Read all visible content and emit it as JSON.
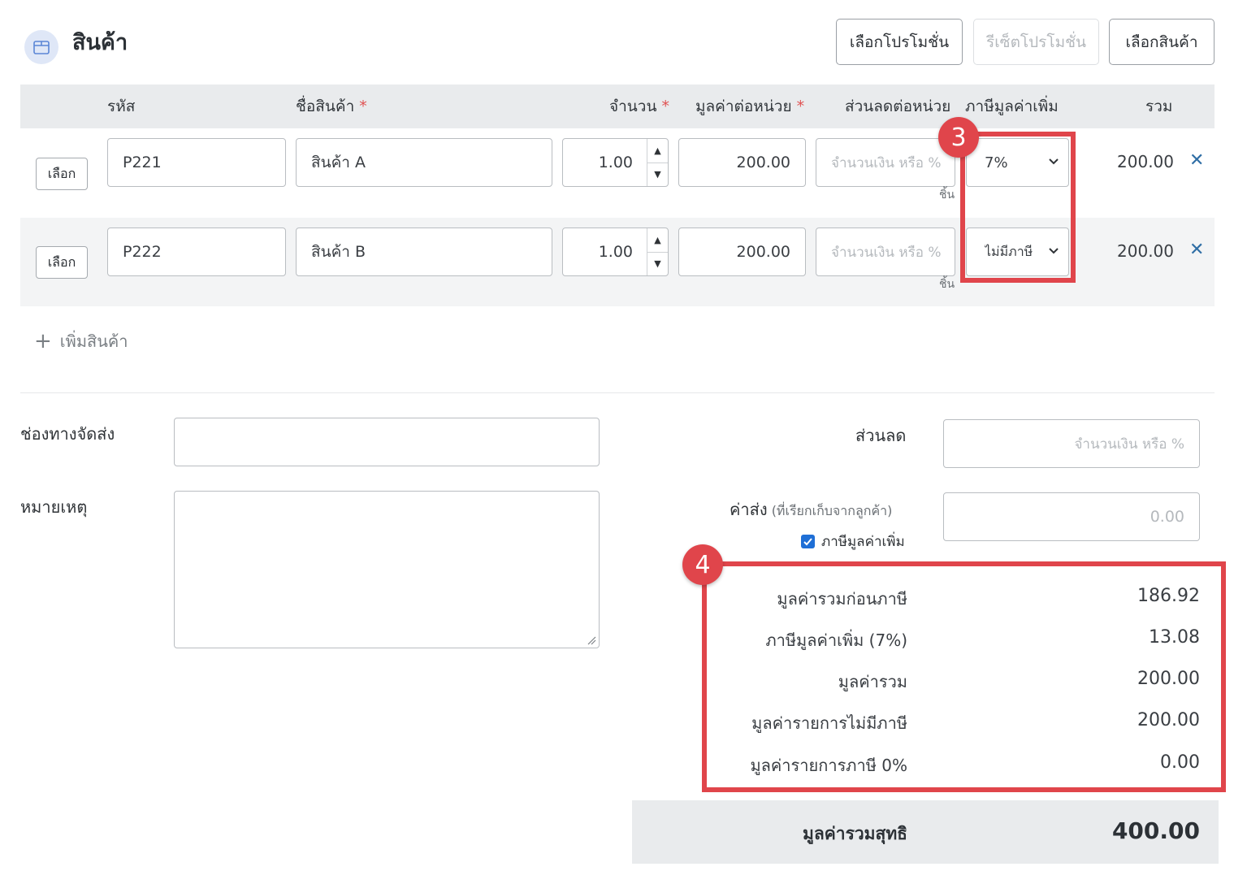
{
  "header": {
    "title": "สินค้า",
    "icon": "box-icon",
    "buttons": {
      "select_promotion": "เลือกโปรโมชั่น",
      "reset_promotion": "รีเซ็ตโปรโมชั่น",
      "select_product": "เลือกสินค้า"
    }
  },
  "table": {
    "columns": {
      "code": "รหัส",
      "name": "ชื่อสินค้า",
      "qty": "จำนวน",
      "unit_price": "มูลค่าต่อหน่วย",
      "discount": "ส่วนลดต่อหน่วย",
      "vat": "ภาษีมูลค่าเพิ่ม",
      "total": "รวม",
      "required_mark": "*"
    },
    "rows": [
      {
        "select_label": "เลือก",
        "code": "P221",
        "name": "สินค้า A",
        "qty": "1.00",
        "unit": "ชิ้น",
        "unit_price": "200.00",
        "discount_placeholder": "จำนวนเงิน หรือ %",
        "vat": "7%",
        "total": "200.00"
      },
      {
        "select_label": "เลือก",
        "code": "P222",
        "name": "สินค้า B",
        "qty": "1.00",
        "unit": "ชิ้น",
        "unit_price": "200.00",
        "discount_placeholder": "จำนวนเงิน หรือ %",
        "vat": "ไม่มีภาษี",
        "total": "200.00"
      }
    ],
    "add_item_label": "เพิ่มสินค้า"
  },
  "form": {
    "shipping_channel_label": "ช่องทางจัดส่ง",
    "shipping_channel_value": "",
    "note_label": "หมายเหตุ",
    "note_value": "",
    "discount_label": "ส่วนลด",
    "discount_placeholder": "จำนวนเงิน หรือ %",
    "shipping_fee_label": "ค่าส่ง",
    "shipping_fee_note": "(ที่เรียกเก็บจากลูกค้า)",
    "shipping_fee_placeholder": "0.00",
    "vat_checkbox_label": "ภาษีมูลค่าเพิ่ม",
    "vat_checked": true
  },
  "summary": {
    "items": [
      {
        "label": "มูลค่ารวมก่อนภาษี",
        "value": "186.92"
      },
      {
        "label": "ภาษีมูลค่าเพิ่ม (7%)",
        "value": "13.08"
      },
      {
        "label": "มูลค่ารวม",
        "value": "200.00"
      },
      {
        "label": "มูลค่ารายการไม่มีภาษี",
        "value": "200.00"
      },
      {
        "label": "มูลค่ารายการภาษี 0%",
        "value": "0.00"
      }
    ],
    "net_label": "มูลค่ารวมสุทธิ",
    "net_value": "400.00"
  },
  "annotations": {
    "badge_vat_column": "3",
    "badge_summary": "4",
    "highlight_color": "#e0454b"
  }
}
